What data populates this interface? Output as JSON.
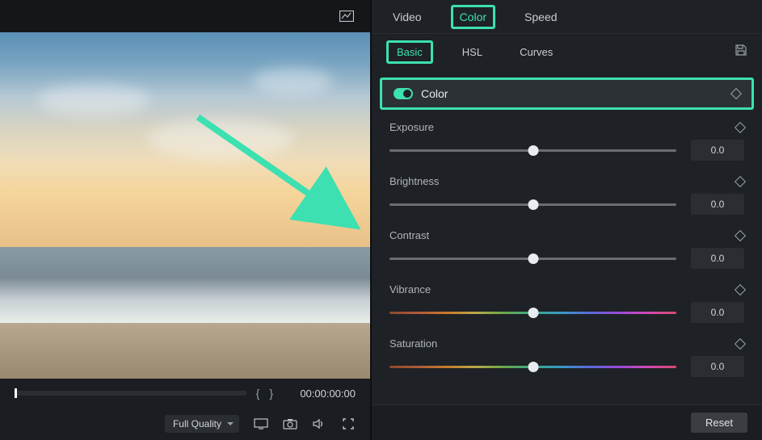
{
  "tabs": {
    "video": "Video",
    "color": "Color",
    "speed": "Speed"
  },
  "subtabs": {
    "basic": "Basic",
    "hsl": "HSL",
    "curves": "Curves"
  },
  "section": {
    "title": "Color"
  },
  "sliders": {
    "exposure": {
      "label": "Exposure",
      "value": "0.0",
      "pos": 50
    },
    "brightness": {
      "label": "Brightness",
      "value": "0.0",
      "pos": 50
    },
    "contrast": {
      "label": "Contrast",
      "value": "0.0",
      "pos": 50
    },
    "vibrance": {
      "label": "Vibrance",
      "value": "0.0",
      "pos": 50
    },
    "saturation": {
      "label": "Saturation",
      "value": "0.0",
      "pos": 50
    }
  },
  "player": {
    "timecode": "00:00:00:00",
    "quality": "Full Quality"
  },
  "buttons": {
    "reset": "Reset"
  }
}
